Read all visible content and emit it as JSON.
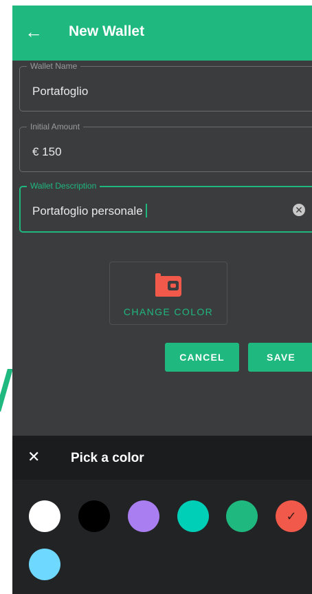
{
  "appbar": {
    "back_icon": "arrow-left-icon",
    "title": "New Wallet"
  },
  "form": {
    "name": {
      "label": "Wallet Name",
      "value": "Portafoglio"
    },
    "amount": {
      "label": "Initial Amount",
      "value": "€ 150"
    },
    "description": {
      "label": "Wallet Description",
      "value": "Portafoglio personale",
      "clear_icon": "clear-circle-icon"
    }
  },
  "color_picker_trigger": {
    "icon": "wallet-icon",
    "icon_color": "#f15a4a",
    "label": "CHANGE COLOR"
  },
  "actions": {
    "cancel": "CANCEL",
    "save": "SAVE"
  },
  "sheet": {
    "close_icon": "close-icon",
    "title": "Pick a color",
    "colors": [
      {
        "name": "white",
        "hex": "#ffffff",
        "selected": false
      },
      {
        "name": "black",
        "hex": "#000000",
        "selected": false
      },
      {
        "name": "purple",
        "hex": "#a97ef0",
        "selected": false
      },
      {
        "name": "turquoise",
        "hex": "#00cfb8",
        "selected": false
      },
      {
        "name": "green",
        "hex": "#1fb87f",
        "selected": false
      },
      {
        "name": "red",
        "hex": "#f15a4a",
        "selected": true,
        "check_mark": "✓"
      },
      {
        "name": "light-blue",
        "hex": "#6fd8ff",
        "selected": false
      }
    ]
  }
}
